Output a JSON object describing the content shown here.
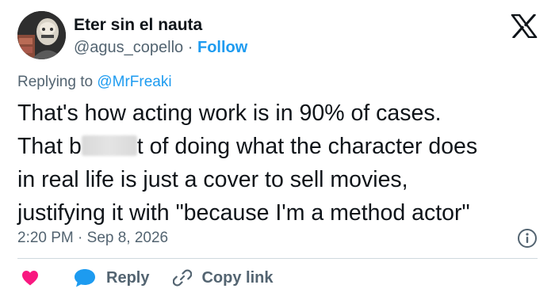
{
  "author": {
    "display_name": "Eter sin el nauta",
    "handle": "@agus_copello",
    "separator": "·",
    "follow_label": "Follow"
  },
  "reply_context": {
    "prefix": "Replying to ",
    "mention": "@MrFreaki"
  },
  "tweet": {
    "lines": [
      "That's how acting work is in 90% of cases.",
      "t of doing what the character does",
      "in real life is just a cover to sell movies,",
      "justifying it with \"because I'm a method actor\""
    ],
    "line2_prefix": "That b"
  },
  "timestamp": "2:20 PM · Sep 8, 2026",
  "actions": {
    "reply_label": "Reply",
    "copy_link_label": "Copy link"
  },
  "icons": {
    "brand": "x-logo-icon",
    "like": "heart-icon",
    "reply": "speech-bubble-icon",
    "copy": "link-icon",
    "info": "info-icon"
  },
  "colors": {
    "accent": "#1d9bf0",
    "heart": "#f91880",
    "muted": "#536471",
    "text": "#0f1419"
  }
}
